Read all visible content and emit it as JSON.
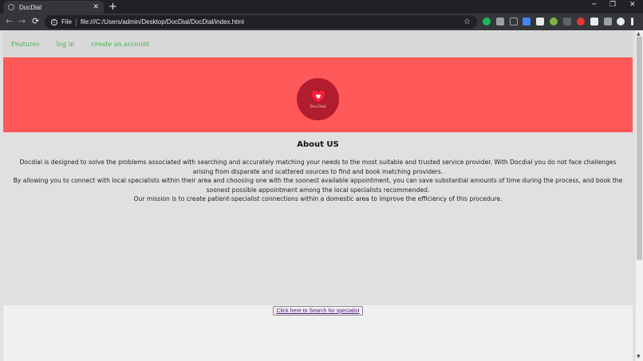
{
  "browser": {
    "tab_title": "DocDial",
    "tab_close": "✕",
    "new_tab": "+",
    "window_controls": {
      "minimize": "─",
      "restore": "❐",
      "close": "✕"
    },
    "nav": {
      "back": "←",
      "forward": "→",
      "reload": "⟳"
    },
    "omnibox": {
      "info": "i",
      "scheme_label": "File",
      "url": "file:///C:/Users/admin/Desktop/DocDial/DocDial/index.html",
      "star": "☆"
    }
  },
  "site": {
    "nav": {
      "features": "Features",
      "login": "log in",
      "create_account": "create an account"
    },
    "logo_text": "DocDial",
    "about": {
      "heading": "About US",
      "paragraph1": "Docdial is designed to solve the problems associated with searching and accurately matching your needs to the most suitable and trusted service provider. With Docdial you do not face challenges arising from disparate and scattered sources to find and book matching providers.",
      "paragraph2": "By allowing you to connect with local specialists within their area and choosing one with the soonest available appointment, you can save substantial amounts of time during the process, and book the soonest possible appointment among the local specialists recommended.",
      "paragraph3": "Our mission is to create patient-specialist connections within a domestic area to improve the efficiency of this procedure."
    },
    "search_button": "Click here to Search for specialist"
  },
  "colors": {
    "hero": "#fe5858",
    "logo_circle": "#b11c2f",
    "nav_link": "#4caf50",
    "page_bg": "#e0e0e0"
  }
}
